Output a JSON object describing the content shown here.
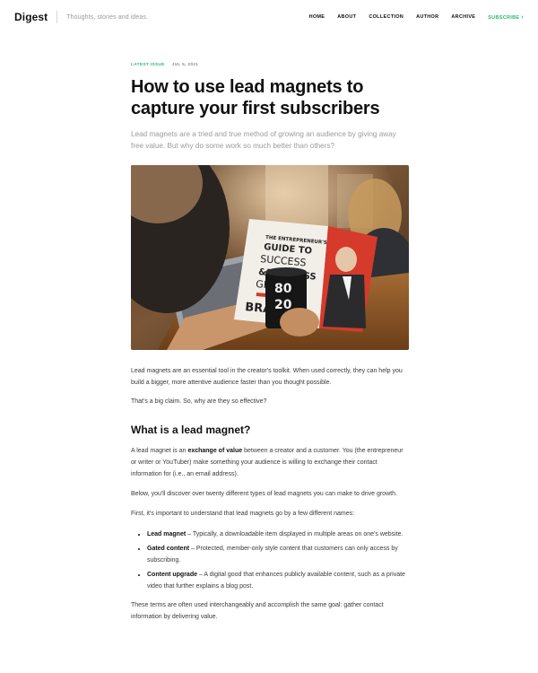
{
  "header": {
    "brand": "Digest",
    "tagline": "Thoughts, stories and ideas.",
    "nav": [
      {
        "label": "HOME"
      },
      {
        "label": "ABOUT"
      },
      {
        "label": "COLLECTION"
      },
      {
        "label": "AUTHOR"
      },
      {
        "label": "ARCHIVE"
      }
    ],
    "subscribe": {
      "label": "SUBSCRIBE",
      "icon": "chevron-right-icon"
    },
    "accent": "#2fb872"
  },
  "article": {
    "tag": "LATEST ISSUE",
    "date": "JUL 5, 2021",
    "title": "How to use lead magnets to capture your first subscribers",
    "lede": "Lead magnets are a tried and true method of growing an audience by giving away free value. But why do some work so much better than others?",
    "hero": {
      "book_title_line1": "THE ENTREPRENEUR'S",
      "book_title_line2": "GUIDE TO",
      "book_title_line3": "SUCCESS",
      "book_title_line4": "BUSINESS",
      "book_title_line5": "GROWTH",
      "book_title_line6": "BRA",
      "mug_text": "80 20"
    },
    "p1": "Lead magnets are an essential tool in the creator's toolkit. When used correctly, they can help you build a bigger, more attentive audience faster than you thought possible.",
    "p2": "That's a big claim. So, why are they so effective?",
    "h2": "What is a lead magnet?",
    "p3_prefix": "A lead magnet is an ",
    "p3_strong": "exchange of value",
    "p3_suffix": " between a creator and a customer. You (the entrepreneur or writer or YouTuber) make something your audience is willing to exchange their contact information for (i.e., an email address).",
    "p4": "Below, you'll discover over twenty different types of lead magnets you can make to drive growth.",
    "p5": "First, it's important to understand that lead magnets go by a few different names:",
    "list": [
      {
        "term": "Lead magnet",
        "desc": " – Typically, a downloadable item displayed in multiple areas on one's website."
      },
      {
        "term": "Gated content",
        "desc": " – Protected, member-only style content that customers can only access by subscribing."
      },
      {
        "term": "Content upgrade",
        "desc": " – A digital good that enhances publicly available content, such as a private video that further explains a blog post."
      }
    ],
    "p6": "These terms are often used interchangeably and accomplish the same goal: gather contact information by delivering value."
  }
}
